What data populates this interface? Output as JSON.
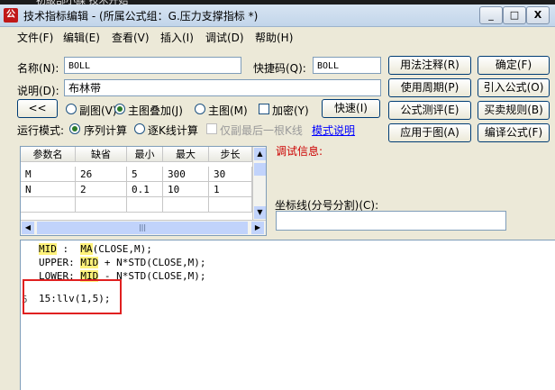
{
  "background": {
    "partial_text": "初級部小課 技术开始"
  },
  "window": {
    "title": "技术指标编辑 - (所属公式组：G.压力支撑指标 *)",
    "controls": [
      "_",
      "□",
      "X"
    ]
  },
  "menu": [
    "文件(F)",
    "编辑(E)",
    "查看(V)",
    "插入(I)",
    "调试(D)",
    "帮助(H)"
  ],
  "form": {
    "name_label": "名称(N):",
    "name_value": "BOLL",
    "shortcut_label": "快捷码(Q):",
    "shortcut_value": "BOLL",
    "desc_label": "说明(D):",
    "desc_value": "布林带",
    "collapse_button": "<<",
    "radio_sub": "副图(V)",
    "radio_main_overlay": "主图叠加(J)",
    "radio_main": "主图(M)",
    "encrypt_label": "加密(Y)",
    "quick_button": "快速(I)",
    "run_mode_label": "运行模式:",
    "radio_seq": "序列计算",
    "radio_tick": "逐K线计算",
    "last_bar_label": "仅副最后一根K线",
    "mode_link": "模式说明"
  },
  "buttons": {
    "usage_notes": "用法注释(R)",
    "ok": "确定(F)",
    "usage_period": "使用周期(P)",
    "import_formula": "引入公式(O)",
    "formula_test": "公式测评(E)",
    "buy_sell_rules": "买卖规则(B)",
    "apply_to_chart": "应用于图(A)",
    "compile": "编译公式(F)"
  },
  "param_table": {
    "headers": [
      "参数名",
      "缺省",
      "最小",
      "最大",
      "步长"
    ],
    "rows": [
      [
        "M",
        "26",
        "5",
        "300",
        "30"
      ],
      [
        "N",
        "2",
        "0.1",
        "10",
        "1"
      ]
    ]
  },
  "debug": {
    "label": "调试信息:"
  },
  "coord": {
    "label": "坐标线(分号分割)(C):",
    "value": ""
  },
  "editor": {
    "lines": [
      {
        "var": "MID",
        "rest": " :  ",
        "fn": "MA",
        "tail": "(CLOSE,M);"
      },
      {
        "var": "UPPER",
        "rest": ": ",
        "hlvar": "MID",
        "tail": " + N*STD(CLOSE,M);"
      },
      {
        "var": "LOWER",
        "rest": ": ",
        "hlvar": "MID",
        "tail": " - N*STD(CLOSE,M);"
      }
    ],
    "line_number": "5",
    "highlighted_line": "15:llv(1,5);"
  },
  "colors": {
    "highlight_box": "#e02020",
    "debug_label": "#cc0000",
    "link": "#0000ff"
  }
}
